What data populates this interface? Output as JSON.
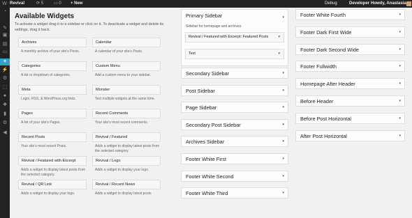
{
  "adminbar": {
    "logo_icon": "wordpress-icon",
    "site_name": "Revival",
    "updates": "5",
    "comments": "0",
    "new_label": "+ New",
    "debug": "Debug",
    "developer": "Developer",
    "howdy": "Howdy, Anastasia"
  },
  "menu_icons": [
    "dashboard-icon",
    "pin-icon",
    "media-icon",
    "pages-icon",
    "comments-icon",
    "appearance-icon",
    "plugins-icon",
    "settings-icon",
    "widgets-icon",
    "users-icon",
    "tools-icon",
    "slider-icon",
    "gear-icon",
    "collapse-icon"
  ],
  "available": {
    "title": "Available Widgets",
    "description": "To activate a widget drag it to a sidebar or click on it. To deactivate a widget and delete its settings, drag it back.",
    "widgets": [
      {
        "title": "Archives",
        "desc": "A monthly archive of your site's Posts."
      },
      {
        "title": "Calendar",
        "desc": "A calendar of your site's Posts."
      },
      {
        "title": "Categories",
        "desc": "A list or dropdown of categories."
      },
      {
        "title": "Custom Menu",
        "desc": "Add a custom menu to your sidebar."
      },
      {
        "title": "Meta",
        "desc": "Login, RSS, & WordPress.org links."
      },
      {
        "title": "Monster",
        "desc": "Test multiple widgets at the same time."
      },
      {
        "title": "Pages",
        "desc": "A list of your site's Pages."
      },
      {
        "title": "Recent Comments",
        "desc": "Your site's most recent comments."
      },
      {
        "title": "Recent Posts",
        "desc": "Your site's most recent Posts."
      },
      {
        "title": "Revival / Featured",
        "desc": "Adds a widget to display latest posts from the selected category."
      },
      {
        "title": "Revival / Featured with Excerpt",
        "desc": "Adds a widget to display latest posts from the selected category."
      },
      {
        "title": "Revival / Logo",
        "desc": "Adds a widget to display your logo."
      },
      {
        "title": "Revival / QR Link",
        "desc": "Adds a widget to display your logo."
      },
      {
        "title": "Revival / Recent News",
        "desc": "Adds a widget to display latest posts"
      }
    ]
  },
  "primary_sidebar": {
    "title": "Primary Sidebar",
    "description": "Sidebar for homepage and archives.",
    "widgets": [
      "Revival / Featured with Excerpt: Featured Posts",
      "Text"
    ]
  },
  "sidebars_mid": [
    "Secondary Sidebar",
    "Post Sidebar",
    "Page Sidebar",
    "Secondary Post Sidebar",
    "Archives Sidebar",
    "Footer White First",
    "Footer White Second",
    "Footer White Third"
  ],
  "sidebars_right": [
    "Footer White Fourth",
    "Footer Dark First Wide",
    "Footer Dark Second Wide",
    "Footer Fullwidth",
    "Homepage After Header",
    "Before Header",
    "Before Post Horizontal",
    "After Post Horizontal"
  ],
  "arrow_icon": "▾",
  "colors": {
    "adminbar": "#222222",
    "menu_current": "#2ea2cc",
    "background": "#f1f1f1"
  }
}
